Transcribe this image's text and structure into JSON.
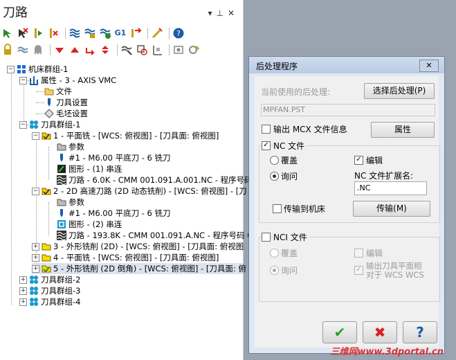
{
  "panel": {
    "title": "刀路",
    "controls": [
      "▾",
      "⊥",
      "✕"
    ]
  },
  "toolbar1": [
    "select-all-ops",
    "select-all-invalid",
    "regenerate-selected",
    "regenerate-dirty",
    "backplot",
    "verify",
    "simulate",
    "post-selected",
    "G1",
    "toolpath-to-line",
    "help"
  ],
  "toolbar2": [
    "lock",
    "toggle-display",
    "toggle-posting",
    "move-down",
    "move-up",
    "insert-arrow",
    "expand-collapse",
    "only-display-selected",
    "display-related",
    "config",
    "options"
  ],
  "tree": {
    "machine_group": "机床群组-1",
    "properties": "属性 - 3 - AXIS VMC",
    "files": "文件",
    "tool_settings": "刀具设置",
    "stock_setup": "毛坯设置",
    "toolpath_group": "刀具群组-1",
    "op1": {
      "label": "1 - 平面铣 - [WCS: 俯视图] - [刀具面: 俯视图]",
      "params": "参数",
      "tool": "#1 - M6.00 平底刀 - 6 铣刀",
      "geometry": "图形 - (1) 串连",
      "toolpath": "刀路 - 6.0K - CMM 001.091.A.001.NC - 程序号码"
    },
    "op2": {
      "label": "2 - 2D 高速刀路 (2D 动态铣削) - [WCS: 俯视图] - [刀",
      "params": "参数",
      "tool": "#1 - M6.00 平底刀 - 6 铣刀",
      "geometry": "图形 - (2) 串连",
      "toolpath": "刀路 - 193.8K - CMM 001.091.A.NC - 程序号码 0"
    },
    "op3": "3 - 外形铣削 (2D) - [WCS: 俯视图] - [刀具面: 俯视图",
    "op4": "4 - 平面铣 - [WCS: 俯视图] - [刀具面: 俯视图]",
    "op5": "5 - 外形铣削 (2D 倒角) - [WCS: 俯视图] - [刀具面: 俯",
    "group2": "刀具群组-2",
    "group3": "刀具群组-3",
    "group4": "刀具群组-4"
  },
  "dialog": {
    "title": "后处理程序",
    "close": "✕",
    "current_post_label": "当前使用的后处理:",
    "select_post_btn": "选择后处理(P)",
    "post_file": "MPFAN.PST",
    "output_mcx_label": "输出 MCX 文件信息",
    "properties_btn": "属性",
    "nc_file_label": "NC 文件",
    "overwrite": "覆盖",
    "edit": "编辑",
    "ask": "询问",
    "nc_ext_label": "NC 文件扩展名:",
    "nc_ext_value": ".NC",
    "send_to_machine": "传输到机床",
    "send_btn": "传输(M)",
    "nci_file_label": "NCI 文件",
    "nci_overwrite": "覆盖",
    "nci_edit": "编辑",
    "nci_ask": "询问",
    "nci_output_tool_plane": "输出刀具平面相对于 WCS WCS",
    "ok_icon": "✔",
    "cancel_icon": "✖",
    "help_icon": "?"
  },
  "watermark": "三维网www.3dportal.cn"
}
